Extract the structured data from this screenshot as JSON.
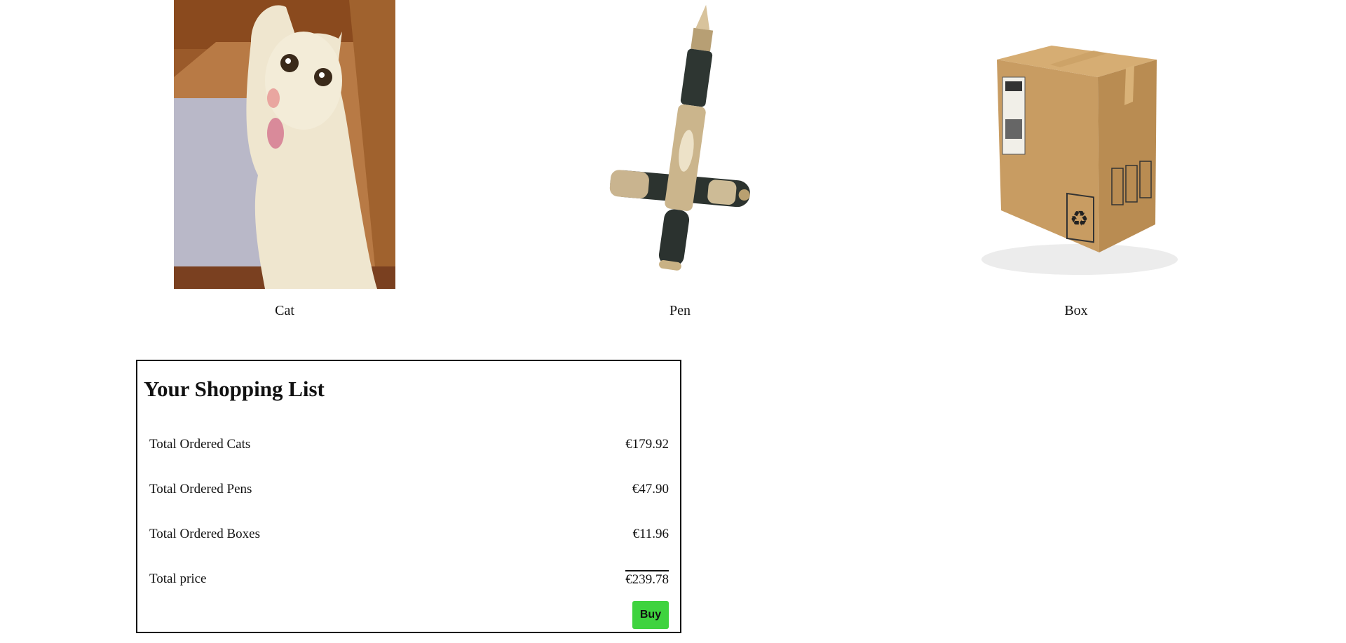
{
  "products": [
    {
      "label": "Cat"
    },
    {
      "label": "Pen"
    },
    {
      "label": "Box"
    }
  ],
  "cart": {
    "title": "Your Shopping List",
    "rows": [
      {
        "name": "Total Ordered Cats",
        "price": "€179.92"
      },
      {
        "name": "Total Ordered Pens",
        "price": "€47.90"
      },
      {
        "name": "Total Ordered Boxes",
        "price": "€11.96"
      }
    ],
    "total": {
      "name": "Total price",
      "price": "€239.78"
    },
    "buy_label": "Buy"
  },
  "colors": {
    "buy_button": "#3fd33f",
    "border": "#111111"
  }
}
